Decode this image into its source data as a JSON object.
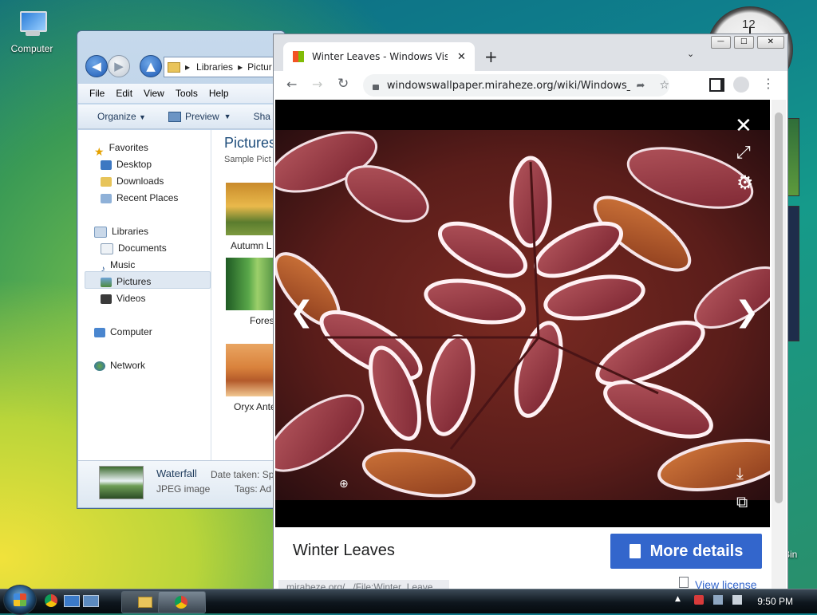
{
  "desktop": {
    "computer_label": "Computer",
    "recycle_label": "Bin",
    "clock_twelve": "12"
  },
  "explorer": {
    "breadcrumb": [
      "Libraries",
      "Pictur"
    ],
    "menu": [
      "File",
      "Edit",
      "View",
      "Tools",
      "Help"
    ],
    "commands": {
      "organize": "Organize",
      "preview": "Preview",
      "share": "Sha"
    },
    "favorites": {
      "header": "Favorites",
      "items": [
        "Desktop",
        "Downloads",
        "Recent Places"
      ]
    },
    "libraries": {
      "header": "Libraries",
      "items": [
        "Documents",
        "Music",
        "Pictures",
        "Videos"
      ]
    },
    "computer": "Computer",
    "network": "Network",
    "content": {
      "title": "Pictures",
      "subtitle": "Sample Pict",
      "thumbs": [
        "Autumn L",
        "Fores",
        "Oryx Ante"
      ]
    },
    "details": {
      "name": "Waterfall",
      "type": "JPEG image",
      "date_label": "Date taken:",
      "date_value": "Sp",
      "tags_label": "Tags:",
      "tags_value": "Ad"
    }
  },
  "chrome": {
    "tab_title": "Winter Leaves - Windows Vista",
    "new_tab": "+",
    "url": "windowswallpaper.miraheze.org/wiki/Windows_Vi...",
    "viewer": {
      "caption": "Winter Leaves",
      "more_details": "More details",
      "view_license": "View license",
      "file_link": "miraheze.org/.../File:Winter_Leave"
    }
  },
  "taskbar": {
    "time": "9:50 PM"
  },
  "colors": {
    "accent_blue": "#3366cc",
    "chrome_frame": "#dee1e6",
    "explorer_frame": "#b5cbe3"
  }
}
